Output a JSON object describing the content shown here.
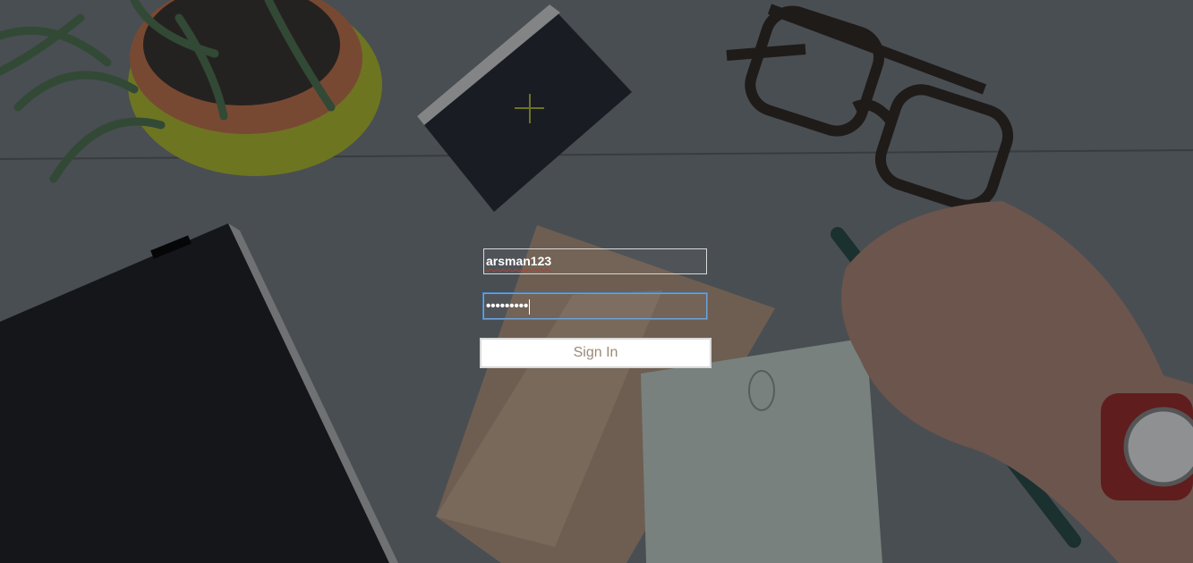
{
  "login": {
    "username_value": "arsman123",
    "password_value": "•••••••••",
    "signin_label": "Sign In"
  },
  "colors": {
    "desk": "#5a5f63",
    "field_border": "#d8d8d8",
    "focus_border": "#6fa3dc",
    "button_bg": "#ffffff",
    "button_text": "#9a8a78"
  },
  "background_objects": [
    "potted-plant",
    "black-notebook-small",
    "eyeglasses",
    "black-notebook-large",
    "kraft-envelope",
    "notecard",
    "hand-with-pencil",
    "wristwatch"
  ]
}
